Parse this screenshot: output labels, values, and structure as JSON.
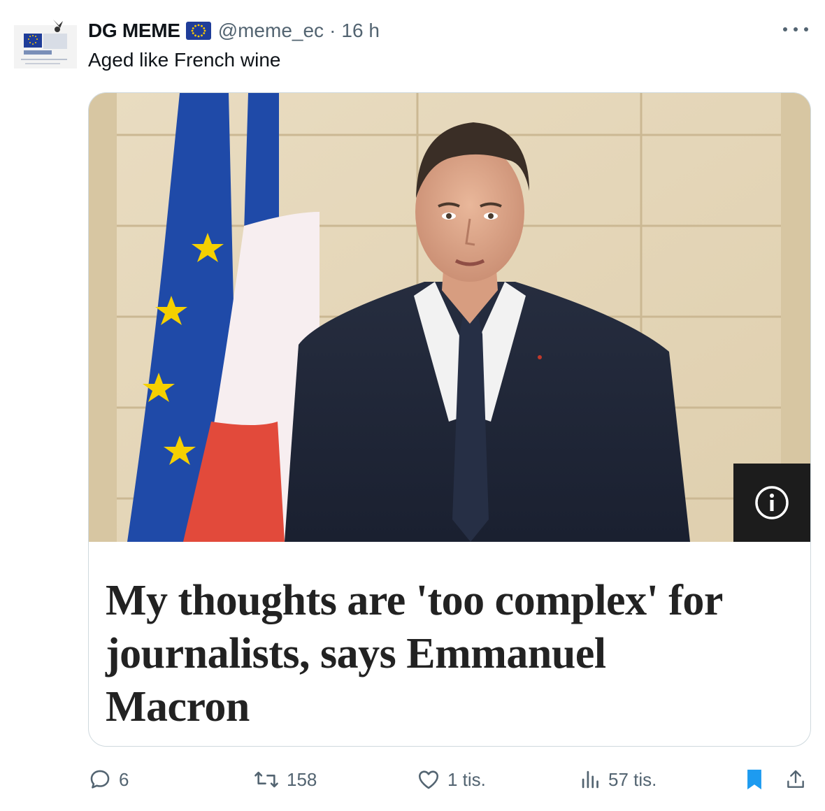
{
  "author": {
    "name": "DG MEME",
    "handle": "@meme_ec",
    "separator": "·",
    "time": "16 h",
    "avatar_label": "DG MEME"
  },
  "tweet": {
    "text": "Aged like French wine"
  },
  "card": {
    "headline_lines": [
      "My thoughts are 'too complex' for",
      "journalists, says Emmanuel",
      "Macron"
    ]
  },
  "actions": {
    "reply": "6",
    "retweet": "158",
    "like": "1 tis.",
    "views": "57 tis."
  },
  "colors": {
    "muted": "#536471",
    "bookmark_active": "#1d9bf0",
    "border": "#cfd9de",
    "eu_blue": "#1f3d99",
    "eu_star": "#ffcc00"
  },
  "icons": {
    "reply": "reply-icon",
    "retweet": "retweet-icon",
    "like": "like-icon",
    "views": "views-icon",
    "bookmark": "bookmark-icon",
    "share": "share-icon",
    "more": "more-icon",
    "info": "info-icon"
  }
}
